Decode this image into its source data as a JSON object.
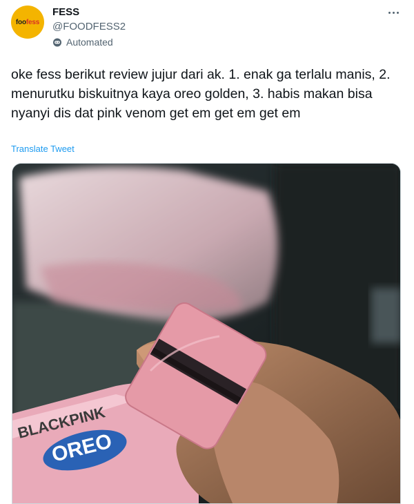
{
  "author": {
    "name": "FESS",
    "handle": "@FOODFESS2",
    "badge": "Automated",
    "avatar_text_part1": "foo",
    "avatar_text_part2": "fess"
  },
  "tweet": {
    "text": "oke fess berikut review jujur dari ak. 1. enak ga terlalu manis, 2. menurutku biskuitnya kaya oreo golden, 3. habis makan bisa nyanyi dis dat pink venom get em get em get em",
    "translate_label": "Translate Tweet"
  },
  "photo": {
    "package_brand": "BLACKPINK",
    "package_logo": "OREO"
  },
  "icons": {
    "more": "more-horizontal-icon",
    "automated": "robot-icon"
  },
  "colors": {
    "link": "#1d9bf0",
    "secondary_text": "#536471",
    "avatar_bg": "#f4b400"
  }
}
